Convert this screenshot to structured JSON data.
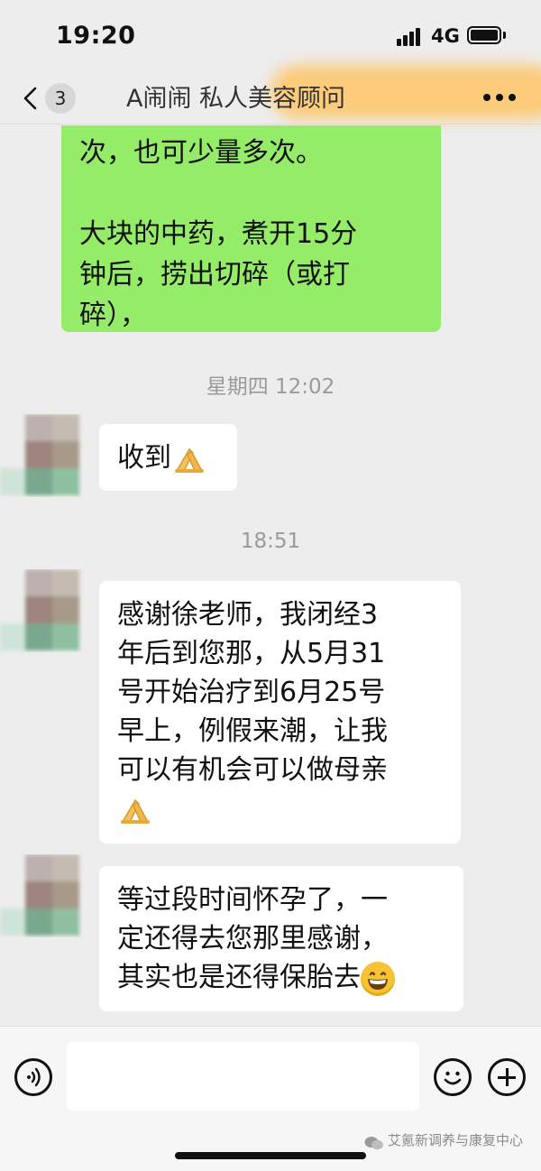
{
  "status_bar": {
    "time": "19:20",
    "network": "4G",
    "icons": [
      "signal-icon",
      "battery-icon"
    ]
  },
  "nav": {
    "back_count": "3",
    "title": "A闹闹   私人美容顾问",
    "icons": [
      "chevron-left-icon",
      "more-dots-icon"
    ]
  },
  "messages": {
    "m1": {
      "sender": "self",
      "line1": "次，也可少量多次。",
      "line2": "大块的中药，煮开15分",
      "line3": "钟后，捞出切碎（或打",
      "line4": "碎），"
    },
    "ts1": "星期四 12:02",
    "m2": {
      "sender": "other",
      "text": "收到"
    },
    "ts2": "18:51",
    "m3": {
      "sender": "other",
      "line1": "感谢徐老师，我闭经3",
      "line2": "年后到您那，从5月31",
      "line3": "号开始治疗到6月25号",
      "line4": "早上，例假来潮，让我",
      "line5": "可以有机会可以做母亲"
    },
    "m4": {
      "sender": "other",
      "line1": "等过段时间怀孕了，一",
      "line2": "定还得去您那里感谢，",
      "line3": "其实也是还得保胎去"
    }
  },
  "input": {
    "value": "",
    "placeholder": ""
  },
  "watermark": "艾氪新调养与康复中心",
  "colors": {
    "background": "#ededed",
    "self_bubble": "#95ec69",
    "other_bubble": "#ffffff",
    "timestamp_text": "#9a9a9a",
    "title_blur": "#ffc464"
  }
}
